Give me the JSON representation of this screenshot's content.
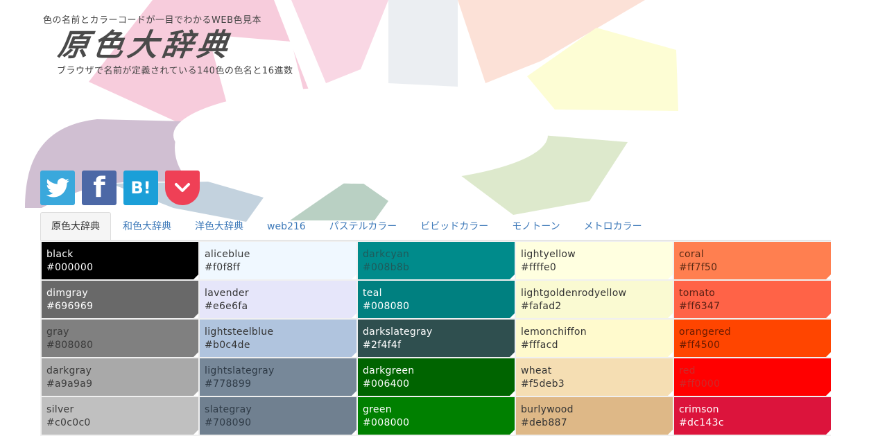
{
  "header": {
    "tagline": "色の名前とカラーコードが一目でわかるWEB色見本",
    "logo": "原色大辞典",
    "subtitle": "ブラウザで名前が定義されている140色の色名と16進数"
  },
  "social": [
    {
      "name": "twitter",
      "label": ""
    },
    {
      "name": "facebook",
      "label": "f"
    },
    {
      "name": "hatena",
      "label": "B!"
    },
    {
      "name": "pocket",
      "label": ""
    }
  ],
  "tabs": [
    {
      "label": "原色大辞典",
      "active": true
    },
    {
      "label": "和色大辞典",
      "active": false
    },
    {
      "label": "洋色大辞典",
      "active": false
    },
    {
      "label": "web216",
      "active": false
    },
    {
      "label": "パステルカラー",
      "active": false
    },
    {
      "label": "ビビッドカラー",
      "active": false
    },
    {
      "label": "モノトーン",
      "active": false
    },
    {
      "label": "メトロカラー",
      "active": false
    }
  ],
  "colors": [
    {
      "name": "black",
      "code": "#000000",
      "bg": "#000000",
      "fg": "#ffffff"
    },
    {
      "name": "aliceblue",
      "code": "#f0f8ff",
      "bg": "#f0f8ff",
      "fg": "#333333"
    },
    {
      "name": "darkcyan",
      "code": "#008b8b",
      "bg": "#008b8b",
      "fg": "#1f5a5a"
    },
    {
      "name": "lightyellow",
      "code": "#ffffe0",
      "bg": "#ffffe0",
      "fg": "#333333"
    },
    {
      "name": "coral",
      "code": "#ff7f50",
      "bg": "#ff7f50",
      "fg": "#5a2a14"
    },
    {
      "name": "dimgray",
      "code": "#696969",
      "bg": "#696969",
      "fg": "#ffffff"
    },
    {
      "name": "lavender",
      "code": "#e6e6fa",
      "bg": "#e6e6fa",
      "fg": "#333333"
    },
    {
      "name": "teal",
      "code": "#008080",
      "bg": "#008080",
      "fg": "#ffffff"
    },
    {
      "name": "lightgoldenrodyellow",
      "code": "#fafad2",
      "bg": "#fafad2",
      "fg": "#333333"
    },
    {
      "name": "tomato",
      "code": "#ff6347",
      "bg": "#ff6347",
      "fg": "#5a2014"
    },
    {
      "name": "gray",
      "code": "#808080",
      "bg": "#808080",
      "fg": "#3a3a3a"
    },
    {
      "name": "lightsteelblue",
      "code": "#b0c4de",
      "bg": "#b0c4de",
      "fg": "#333333"
    },
    {
      "name": "darkslategray",
      "code": "#2f4f4f",
      "bg": "#2f4f4f",
      "fg": "#ffffff"
    },
    {
      "name": "lemonchiffon",
      "code": "#fffacd",
      "bg": "#fffacd",
      "fg": "#333333"
    },
    {
      "name": "orangered",
      "code": "#ff4500",
      "bg": "#ff4500",
      "fg": "#6a1a00"
    },
    {
      "name": "darkgray",
      "code": "#a9a9a9",
      "bg": "#a9a9a9",
      "fg": "#3a3a3a"
    },
    {
      "name": "lightslategray",
      "code": "#778899",
      "bg": "#778899",
      "fg": "#2e3a46"
    },
    {
      "name": "darkgreen",
      "code": "#006400",
      "bg": "#006400",
      "fg": "#ffffff"
    },
    {
      "name": "wheat",
      "code": "#f5deb3",
      "bg": "#f5deb3",
      "fg": "#333333"
    },
    {
      "name": "red",
      "code": "#ff0000",
      "bg": "#ff0000",
      "fg": "#cc2a2a"
    },
    {
      "name": "silver",
      "code": "#c0c0c0",
      "bg": "#c0c0c0",
      "fg": "#3a3a3a"
    },
    {
      "name": "slategray",
      "code": "#708090",
      "bg": "#708090",
      "fg": "#2e3a46"
    },
    {
      "name": "green",
      "code": "#008000",
      "bg": "#008000",
      "fg": "#ffffff"
    },
    {
      "name": "burlywood",
      "code": "#deb887",
      "bg": "#deb887",
      "fg": "#333333"
    },
    {
      "name": "crimson",
      "code": "#dc143c",
      "bg": "#dc143c",
      "fg": "#ffffff"
    }
  ]
}
